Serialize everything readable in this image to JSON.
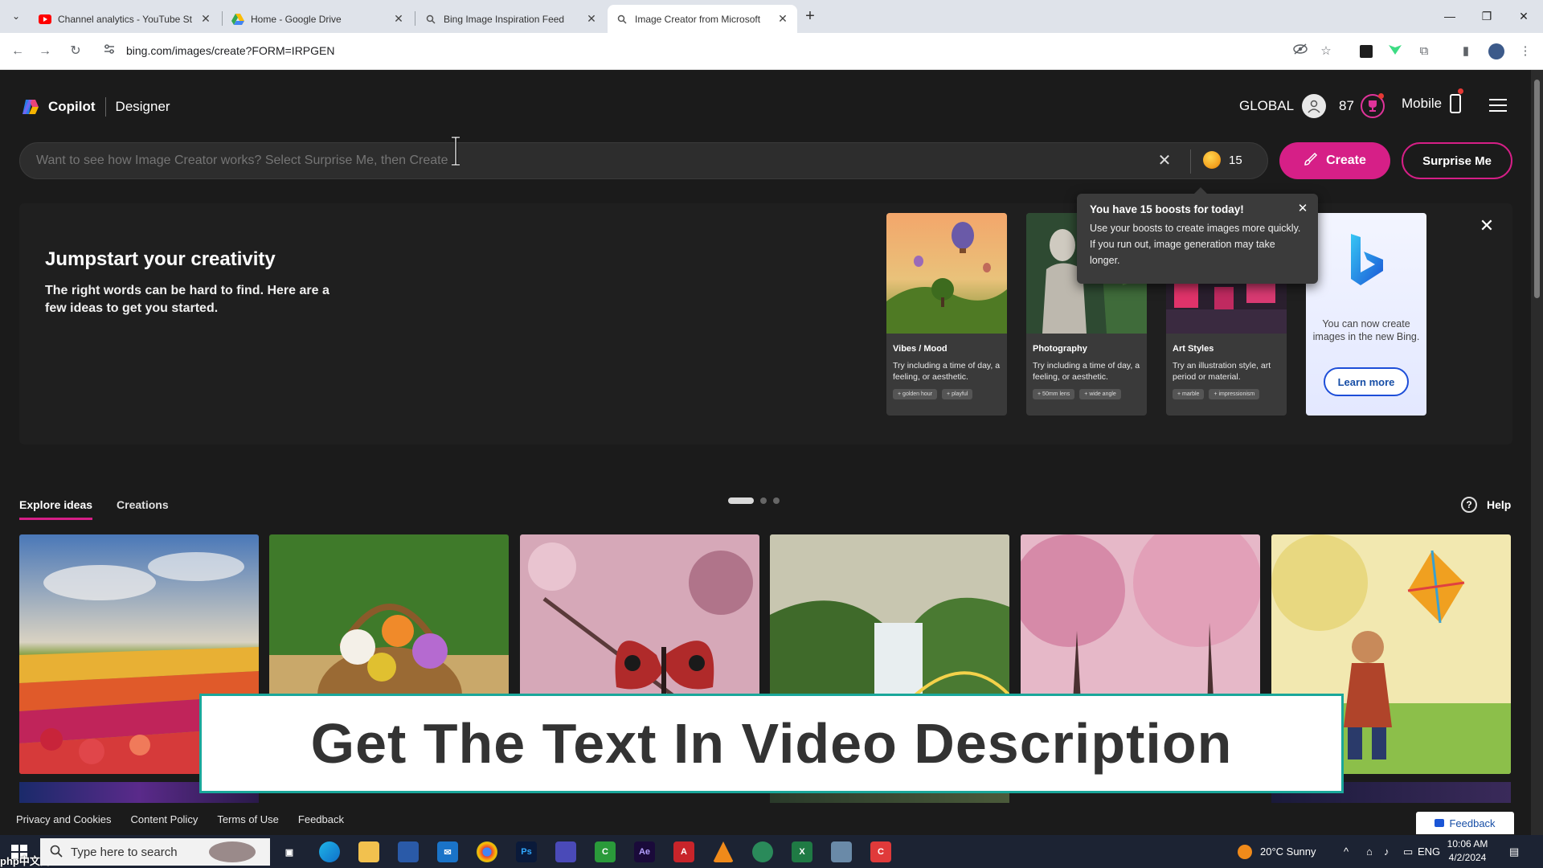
{
  "browser": {
    "tabs": [
      {
        "title": "Channel analytics - YouTube St",
        "icon": "youtube-icon",
        "active": false
      },
      {
        "title": "Home - Google Drive",
        "icon": "google-drive-icon",
        "active": false
      },
      {
        "title": "Bing Image Inspiration Feed",
        "icon": "search-icon",
        "active": false
      },
      {
        "title": "Image Creator from Microsoft",
        "icon": "search-icon",
        "active": true
      }
    ],
    "url": "bing.com/images/create?FORM=IRPGEN"
  },
  "header": {
    "brand": "Copilot",
    "product": "Designer",
    "region": "GLOBAL",
    "points": "87",
    "mobile": "Mobile"
  },
  "prompt": {
    "placeholder": "Want to see how Image Creator works? Select Surprise Me, then Create",
    "boosts": "15",
    "create_label": "Create",
    "surprise_label": "Surprise Me"
  },
  "jumpstart": {
    "title": "Jumpstart your creativity",
    "text": "The right words can be hard to find. Here are a few ideas to get you started.",
    "cards": [
      {
        "title": "Vibes / Mood",
        "desc": "Try including a time of day, a feeling, or aesthetic.",
        "chips": [
          "golden hour",
          "playful"
        ]
      },
      {
        "title": "Photography",
        "desc": "Try including a time of day, a feeling, or aesthetic.",
        "chips": [
          "50mm lens",
          "wide angle"
        ]
      },
      {
        "title": "Art Styles",
        "desc": "Try an illustration style, art period or material.",
        "chips": [
          "marble",
          "impressionism"
        ]
      }
    ],
    "bing_card": {
      "text": "You can now create images in the new Bing.",
      "button": "Learn more"
    }
  },
  "tooltip": {
    "title": "You have 15 boosts for today!",
    "body": "Use your boosts to create images more quickly. If you run out, image generation may take longer."
  },
  "page_tabs": {
    "explore": "Explore ideas",
    "creations": "Creations",
    "help": "Help"
  },
  "banner": {
    "text": "Get The Text In Video Description"
  },
  "footer": {
    "links": [
      "Privacy and Cookies",
      "Content Policy",
      "Terms of Use",
      "Feedback"
    ],
    "feedback_button": "Feedback"
  },
  "taskbar": {
    "search_placeholder": "Type here to search",
    "weather": "20°C  Sunny",
    "lang": "ENG",
    "time": "10:06 AM",
    "date": "4/2/2024",
    "watermark": "php中文网"
  },
  "colors": {
    "accent": "#d61f87",
    "page_bg": "#1b1b1b"
  }
}
